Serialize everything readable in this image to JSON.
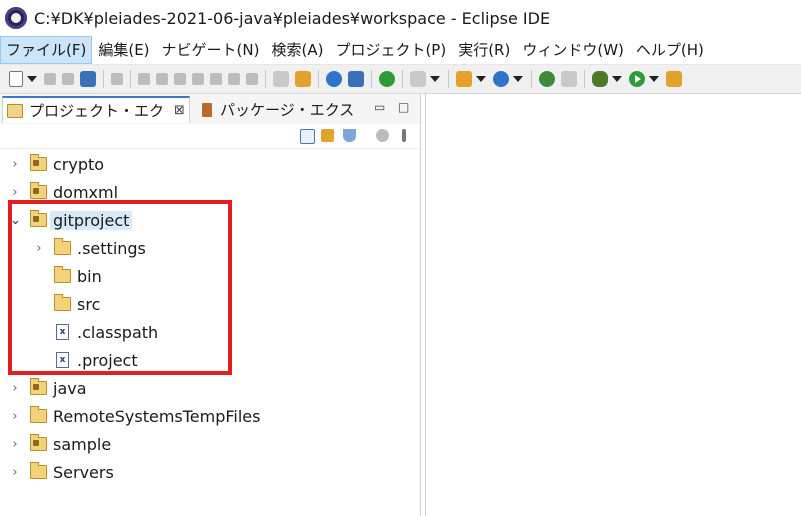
{
  "window": {
    "title": "C:¥DK¥pleiades-2021-06-java¥pleiades¥workspace - Eclipse IDE"
  },
  "menu": {
    "items": [
      {
        "label": "ファイル(F)"
      },
      {
        "label": "編集(E)"
      },
      {
        "label": "ナビゲート(N)"
      },
      {
        "label": "検索(A)"
      },
      {
        "label": "プロジェクト(P)"
      },
      {
        "label": "実行(R)"
      },
      {
        "label": "ウィンドウ(W)"
      },
      {
        "label": "ヘルプ(H)"
      }
    ],
    "active_index": 0
  },
  "tabs": {
    "active": {
      "label": "プロジェクト・エク",
      "close": "⊠"
    },
    "inactive": {
      "label": "パッケージ・エクス"
    },
    "minimize": "▭",
    "maximize": "□"
  },
  "tree": {
    "items": [
      {
        "label": "crypto",
        "type": "project",
        "expanded": false
      },
      {
        "label": "domxml",
        "type": "project",
        "expanded": false
      },
      {
        "label": "gitproject",
        "type": "project",
        "expanded": true,
        "selected": true
      },
      {
        "label": ".settings",
        "type": "folder",
        "expanded": false,
        "indent": 1
      },
      {
        "label": "bin",
        "type": "folder",
        "indent": 1
      },
      {
        "label": "src",
        "type": "folder",
        "indent": 1
      },
      {
        "label": ".classpath",
        "type": "xml-file",
        "indent": 1
      },
      {
        "label": ".project",
        "type": "xml-file",
        "indent": 1
      },
      {
        "label": "java",
        "type": "project",
        "expanded": false
      },
      {
        "label": "RemoteSystemsTempFiles",
        "type": "folder",
        "expanded": false
      },
      {
        "label": "sample",
        "type": "project",
        "expanded": false
      },
      {
        "label": "Servers",
        "type": "folder",
        "expanded": false
      }
    ]
  },
  "icons": {
    "chevron_right": "›",
    "chevron_down": "⌄",
    "xml_mark": "x"
  },
  "colors": {
    "highlight_box": "#e0201f",
    "selection": "#d6eaf9",
    "active_tab_accent": "#3b77c9"
  }
}
